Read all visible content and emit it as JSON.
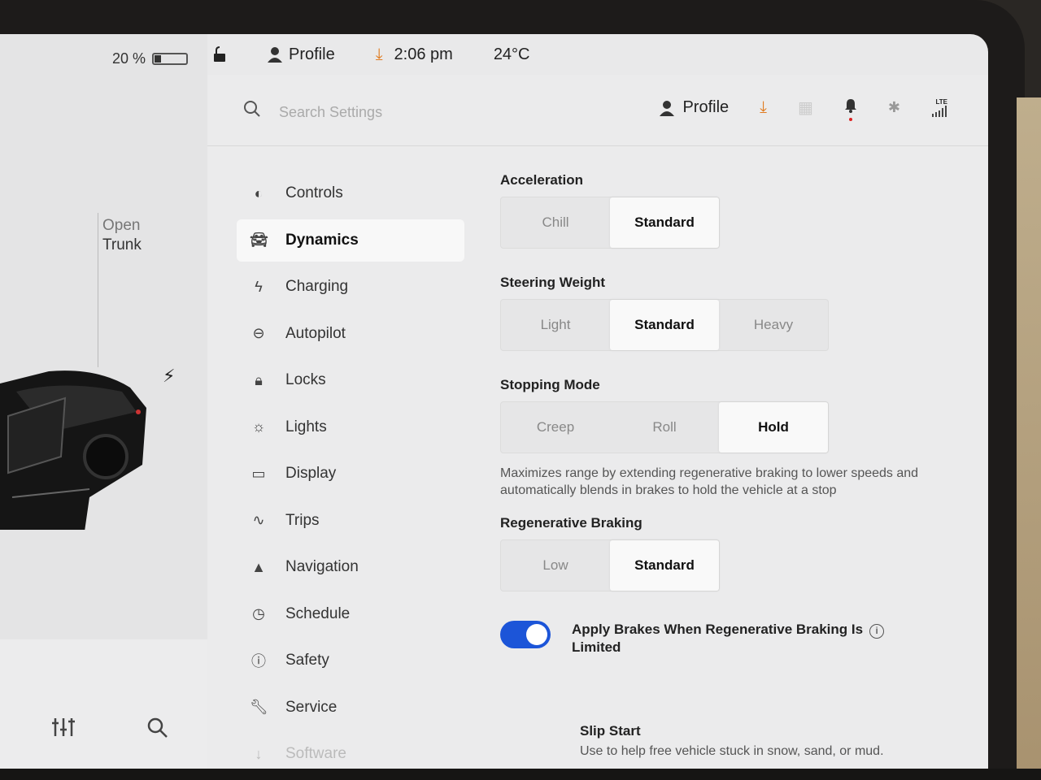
{
  "status": {
    "battery_percent": "20 %",
    "battery_level": 0.2,
    "profile_label": "Profile",
    "time": "2:06 pm",
    "temperature": "24°C"
  },
  "car": {
    "open_trunk_line1": "Open",
    "open_trunk_line2": "Trunk"
  },
  "header": {
    "search_placeholder": "Search Settings",
    "profile_label": "Profile",
    "lte_label": "LTE"
  },
  "nav": {
    "items": [
      {
        "label": "Controls",
        "icon": "toggle-icon"
      },
      {
        "label": "Dynamics",
        "icon": "car-icon",
        "active": true
      },
      {
        "label": "Charging",
        "icon": "bolt-icon"
      },
      {
        "label": "Autopilot",
        "icon": "steering-wheel-icon"
      },
      {
        "label": "Locks",
        "icon": "lock-icon"
      },
      {
        "label": "Lights",
        "icon": "sun-icon"
      },
      {
        "label": "Display",
        "icon": "display-icon"
      },
      {
        "label": "Trips",
        "icon": "trips-icon"
      },
      {
        "label": "Navigation",
        "icon": "navigation-arrow-icon"
      },
      {
        "label": "Schedule",
        "icon": "clock-icon"
      },
      {
        "label": "Safety",
        "icon": "safety-icon"
      },
      {
        "label": "Service",
        "icon": "wrench-icon"
      },
      {
        "label": "Software",
        "icon": "download-icon"
      }
    ]
  },
  "dynamics": {
    "acceleration": {
      "title": "Acceleration",
      "options": [
        "Chill",
        "Standard"
      ],
      "selected": "Standard"
    },
    "steering_weight": {
      "title": "Steering Weight",
      "options": [
        "Light",
        "Standard",
        "Heavy"
      ],
      "selected": "Standard"
    },
    "stopping_mode": {
      "title": "Stopping Mode",
      "options": [
        "Creep",
        "Roll",
        "Hold"
      ],
      "selected": "Hold",
      "description": "Maximizes range by extending regenerative braking to lower speeds and automatically blends in brakes to hold the vehicle at a stop"
    },
    "regenerative_braking": {
      "title": "Regenerative Braking",
      "options": [
        "Low",
        "Standard"
      ],
      "selected": "Standard"
    },
    "apply_brakes": {
      "label_line1": "Apply Brakes When Regenerative Braking Is",
      "label_line2": "Limited",
      "enabled": true
    },
    "slip_start": {
      "title": "Slip Start",
      "description": "Use to help free vehicle stuck in snow, sand, or mud."
    }
  },
  "colors": {
    "accent": "#1c55d8",
    "download": "#e07b20"
  }
}
